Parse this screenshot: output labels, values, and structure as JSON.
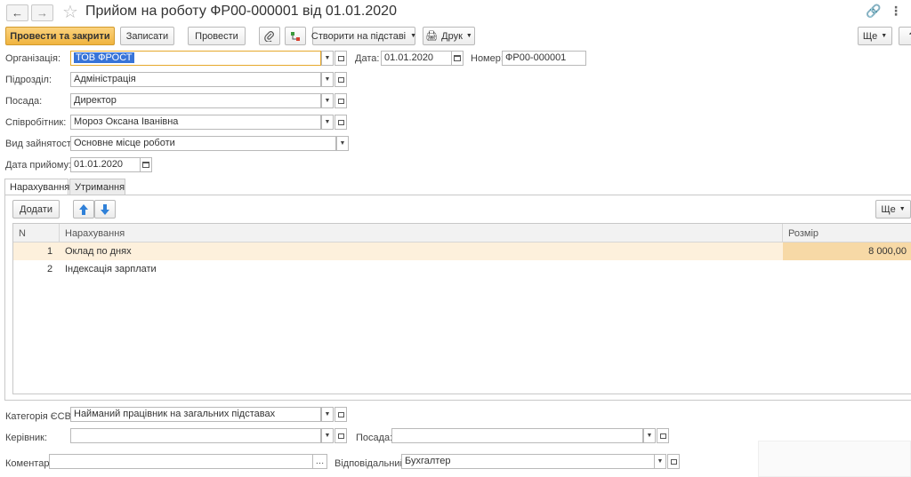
{
  "window": {
    "title": "Прийом на роботу ФР00-000001 від 01.01.2020",
    "more_label": "Ще",
    "help_label": "?"
  },
  "toolbar": {
    "post_close": "Провести та закрити",
    "save": "Записати",
    "post": "Провести",
    "create_based": "Створити на підставі",
    "print": "Друк"
  },
  "form": {
    "organization_label": "Організація:",
    "organization_value": "ТОВ ФРОСТ",
    "date_label": "Дата:",
    "date_value": "01.01.2020",
    "number_label": "Номер:",
    "number_value": "ФР00-000001",
    "department_label": "Підрозділ:",
    "department_value": "Адміністрація",
    "position_label": "Посада:",
    "position_value": "Директор",
    "employee_label": "Співробітник:",
    "employee_value": "Мороз Оксана Іванівна",
    "employment_type_label": "Вид зайнятості:",
    "employment_type_value": "Основне місце роботи",
    "hire_date_label": "Дата прийому:",
    "hire_date_value": "01.01.2020"
  },
  "tabs": [
    {
      "label": "Нарахування",
      "active": true
    },
    {
      "label": "Утримання",
      "active": false
    }
  ],
  "accruals": {
    "add_label": "Додати",
    "more_label": "Ще",
    "columns": {
      "n": "N",
      "accrual": "Нарахування",
      "amount": "Розмір"
    },
    "rows": [
      {
        "n": "1",
        "accrual": "Оклад по днях",
        "amount": "8 000,00"
      },
      {
        "n": "2",
        "accrual": "Індексація зарплати",
        "amount": ""
      }
    ]
  },
  "footer": {
    "esv_label": "Категорія ЄСВ:",
    "esv_value": "Найманий працівник на загальних підставах",
    "manager_label": "Керівник:",
    "manager_value": "",
    "manager_position_label": "Посада:",
    "manager_position_value": "",
    "comment_label": "Коментар:",
    "comment_value": "",
    "responsible_label": "Відповідальний:",
    "responsible_value": "Бухгалтер"
  },
  "colors": {
    "primary_button": "#f0b43f",
    "selected_row": "#fdf0dc",
    "selection": "#3874d8",
    "arrow_blue": "#2f80d8"
  }
}
